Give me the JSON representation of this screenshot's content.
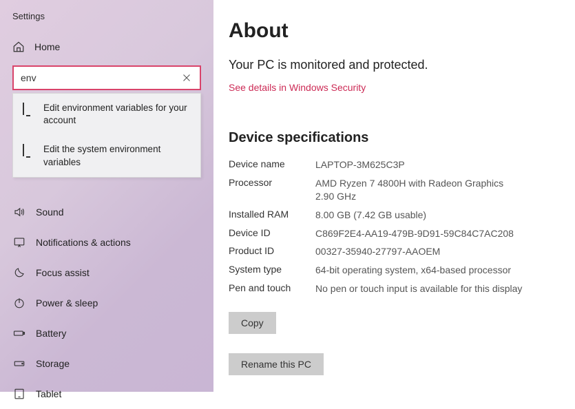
{
  "window": {
    "title": "Settings"
  },
  "sidebar": {
    "home_label": "Home",
    "search": {
      "value": "env",
      "clear_tooltip": "Clear"
    },
    "suggestions": [
      "Edit environment variables for your account",
      "Edit the system environment variables"
    ],
    "items": [
      {
        "label": "Sound"
      },
      {
        "label": "Notifications & actions"
      },
      {
        "label": "Focus assist"
      },
      {
        "label": "Power & sleep"
      },
      {
        "label": "Battery"
      },
      {
        "label": "Storage"
      },
      {
        "label": "Tablet"
      }
    ]
  },
  "main": {
    "title": "About",
    "protected": "Your PC is monitored and protected.",
    "security_link": "See details in Windows Security",
    "spec_title": "Device specifications",
    "specs": {
      "device_name": {
        "label": "Device name",
        "value": "LAPTOP-3M625C3P"
      },
      "processor": {
        "label": "Processor",
        "value": "AMD Ryzen 7 4800H with Radeon Graphics",
        "value2": "2.90 GHz"
      },
      "ram": {
        "label": "Installed RAM",
        "value": "8.00 GB (7.42 GB usable)"
      },
      "device_id": {
        "label": "Device ID",
        "value": "C869F2E4-AA19-479B-9D91-59C84C7AC208"
      },
      "product_id": {
        "label": "Product ID",
        "value": "00327-35940-27797-AAOEM"
      },
      "system_type": {
        "label": "System type",
        "value": "64-bit operating system, x64-based processor"
      },
      "pen_touch": {
        "label": "Pen and touch",
        "value": "No pen or touch input is available for this display"
      }
    },
    "copy_btn": "Copy",
    "rename_btn": "Rename this PC"
  }
}
